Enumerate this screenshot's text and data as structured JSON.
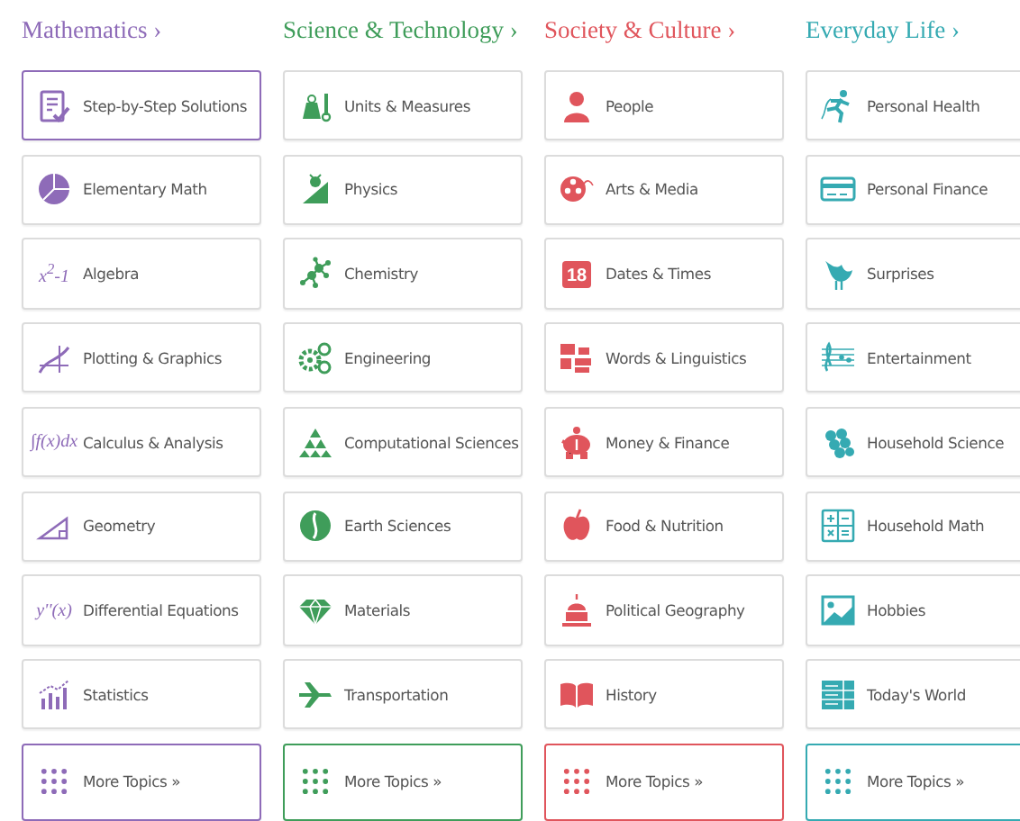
{
  "columns": [
    {
      "title": "Mathematics ›",
      "color": "#8e6bb8",
      "items": [
        {
          "label": "Step-by-Step Solutions",
          "selected": true
        },
        {
          "label": "Elementary Math",
          "selected": false
        },
        {
          "label": "Algebra",
          "selected": false,
          "icon_text": "x$^{2}$-1"
        },
        {
          "label": "Plotting & Graphics",
          "selected": false
        },
        {
          "label": "Calculus & Analysis",
          "selected": false,
          "icon_text": "∫f(x)dx"
        },
        {
          "label": "Geometry",
          "selected": false
        },
        {
          "label": "Differential Equations",
          "selected": false,
          "icon_text": "y''(x)"
        },
        {
          "label": "Statistics",
          "selected": false
        }
      ],
      "more": "More Topics »"
    },
    {
      "title": "Science & Technology ›",
      "color": "#3f9d5a",
      "items": [
        {
          "label": "Units & Measures",
          "selected": false
        },
        {
          "label": "Physics",
          "selected": false
        },
        {
          "label": "Chemistry",
          "selected": false
        },
        {
          "label": "Engineering",
          "selected": false
        },
        {
          "label": "Computational Sciences",
          "selected": false
        },
        {
          "label": "Earth Sciences",
          "selected": false
        },
        {
          "label": "Materials",
          "selected": false
        },
        {
          "label": "Transportation",
          "selected": false
        }
      ],
      "more": "More Topics »"
    },
    {
      "title": "Society & Culture ›",
      "color": "#e0555c",
      "items": [
        {
          "label": "People",
          "selected": false
        },
        {
          "label": "Arts & Media",
          "selected": false
        },
        {
          "label": "Dates & Times",
          "selected": false,
          "icon_text": "18"
        },
        {
          "label": "Words & Linguistics",
          "selected": false
        },
        {
          "label": "Money & Finance",
          "selected": false
        },
        {
          "label": "Food & Nutrition",
          "selected": false
        },
        {
          "label": "Political Geography",
          "selected": false
        },
        {
          "label": "History",
          "selected": false
        }
      ],
      "more": "More Topics »"
    },
    {
      "title": "Everyday Life ›",
      "color": "#35aab2",
      "items": [
        {
          "label": "Personal Health",
          "selected": false
        },
        {
          "label": "Personal Finance",
          "selected": false
        },
        {
          "label": "Surprises",
          "selected": false
        },
        {
          "label": "Entertainment",
          "selected": false
        },
        {
          "label": "Household Science",
          "selected": false
        },
        {
          "label": "Household Math",
          "selected": false
        },
        {
          "label": "Hobbies",
          "selected": false
        },
        {
          "label": "Today's World",
          "selected": false
        }
      ],
      "more": "More Topics »"
    }
  ]
}
